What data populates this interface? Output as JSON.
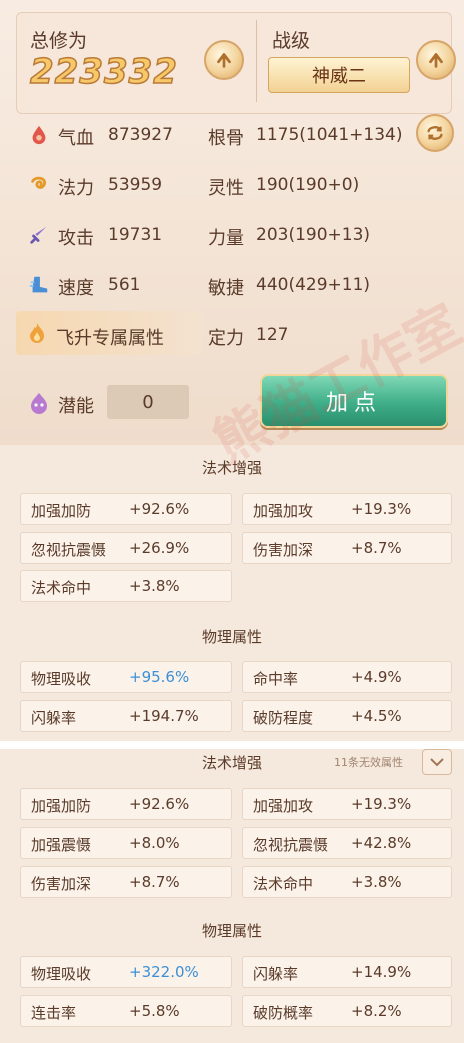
{
  "header": {
    "cultivation_label": "总修为",
    "cultivation_value": "223332",
    "rank_label": "战级",
    "rank_value": "神威二"
  },
  "stats": [
    {
      "icon": "blood-drop-icon",
      "label": "气血",
      "value": "873927"
    },
    {
      "icon": "mana-swirl-icon",
      "label": "法力",
      "value": "53959"
    },
    {
      "icon": "sword-icon",
      "label": "攻击",
      "value": "19731"
    },
    {
      "icon": "boot-icon",
      "label": "速度",
      "value": "561"
    }
  ],
  "attributes": [
    {
      "label": "根骨",
      "value": "1175(1041+134)"
    },
    {
      "label": "灵性",
      "value": "190(190+0)"
    },
    {
      "label": "力量",
      "value": "203(190+13)"
    },
    {
      "label": "敏捷",
      "value": "440(429+11)"
    },
    {
      "label": "定力",
      "value": "127"
    }
  ],
  "ascension_label": "飞升专属属性",
  "potential": {
    "label": "潜能",
    "value": "0"
  },
  "add_point_label": "加点",
  "sections": [
    {
      "title": "法术增强",
      "rows": [
        [
          {
            "k": "加强加防",
            "v": "+92.6%"
          },
          {
            "k": "加强加攻",
            "v": "+19.3%"
          }
        ],
        [
          {
            "k": "忽视抗震慑",
            "v": "+26.9%"
          },
          {
            "k": "伤害加深",
            "v": "+8.7%"
          }
        ],
        [
          {
            "k": "法术命中",
            "v": "+3.8%"
          }
        ]
      ]
    },
    {
      "title": "物理属性",
      "rows": [
        [
          {
            "k": "物理吸收",
            "v": "+95.6%",
            "highlight": true
          },
          {
            "k": "命中率",
            "v": "+4.9%"
          }
        ],
        [
          {
            "k": "闪躲率",
            "v": "+194.7%"
          },
          {
            "k": "破防程度",
            "v": "+4.5%"
          }
        ]
      ]
    },
    {
      "title": "法术增强",
      "note": "11条无效属性",
      "rows": [
        [
          {
            "k": "加强加防",
            "v": "+92.6%"
          },
          {
            "k": "加强加攻",
            "v": "+19.3%"
          }
        ],
        [
          {
            "k": "加强震慑",
            "v": "+8.0%"
          },
          {
            "k": "忽视抗震慑",
            "v": "+42.8%"
          }
        ],
        [
          {
            "k": "伤害加深",
            "v": "+8.7%"
          },
          {
            "k": "法术命中",
            "v": "+3.8%"
          }
        ]
      ]
    },
    {
      "title": "物理属性",
      "rows": [
        [
          {
            "k": "物理吸收",
            "v": "+322.0%",
            "highlight": true
          },
          {
            "k": "闪躲率",
            "v": "+14.9%"
          }
        ],
        [
          {
            "k": "连击率",
            "v": "+5.8%"
          },
          {
            "k": "破防概率",
            "v": "+8.2%"
          }
        ]
      ]
    }
  ],
  "watermark": "熊猫工作室",
  "colors": {
    "highlight_value": "#3c8fd6",
    "add_button": "#3fae88",
    "gold": "#f7c86a"
  }
}
